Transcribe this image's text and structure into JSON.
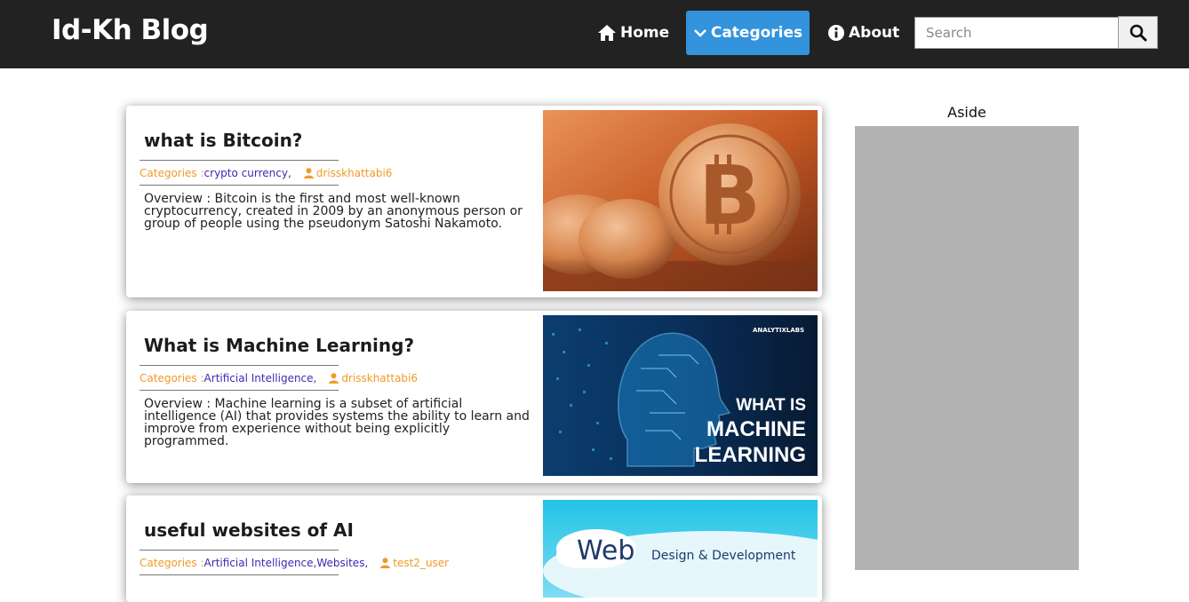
{
  "brand": "Id-Kh Blog",
  "nav": {
    "home": "Home",
    "categories": "Categories",
    "about": "About",
    "search_placeholder": "Search"
  },
  "posts": [
    {
      "title": "what is Bitcoin?",
      "categories_label": "Categories :",
      "categories": "crypto currency,",
      "author": "drisskhattabi6",
      "overview": "Overview : Bitcoin is the first and most well-known cryptocurrency, created in 2009 by an anonymous person or group of people using the pseudonym Satoshi Nakamoto.",
      "image": "bitcoin-coins-image"
    },
    {
      "title": "What is Machine Learning?",
      "categories_label": "Categories :",
      "categories": "Artificial Intelligence,",
      "author": "drisskhattabi6",
      "overview": "Overview : Machine learning is a subset of artificial intelligence (AI) that provides systems the ability to learn and improve from experience without being explicitly programmed.",
      "image_brand": "ANALYTIXLABS",
      "image_text": [
        "WHAT IS",
        "MACHINE",
        "LEARNING"
      ]
    },
    {
      "title": "useful websites of AI",
      "categories_label": "Categories :",
      "categories": "Artificial Intelligence,Websites,",
      "author": "test2_user",
      "image_text_big": "Web",
      "image_text_small": "Design & Development"
    }
  ],
  "aside": {
    "title": "Aside"
  },
  "colors": {
    "topbar": "#222222",
    "accent": "#3393dc",
    "meta": "#f29a27",
    "category_link": "#3b2bb3",
    "aside_box": "#b3b3b3"
  }
}
